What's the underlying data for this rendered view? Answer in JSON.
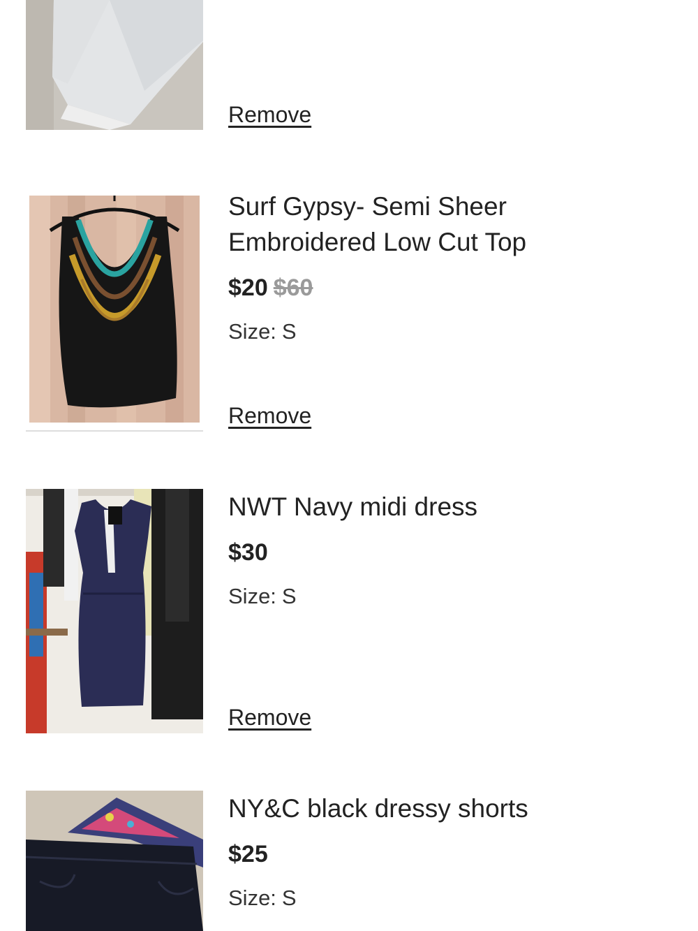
{
  "cart": {
    "items": [
      {
        "title": "",
        "price": "",
        "original_price": "",
        "size_label": "",
        "size": "",
        "remove_label": "Remove",
        "image": "grey-pants-photo"
      },
      {
        "title": "Surf Gypsy- Semi Sheer Embroidered Low Cut Top",
        "price": "$20",
        "original_price": "$60",
        "size_label": "Size:",
        "size": "S",
        "remove_label": "Remove",
        "image": "embroidered-top-photo"
      },
      {
        "title": "NWT Navy midi dress",
        "price": "$30",
        "original_price": "",
        "size_label": "Size:",
        "size": "S",
        "remove_label": "Remove",
        "image": "navy-dress-photo"
      },
      {
        "title": "NY&C black dressy shorts",
        "price": "$25",
        "original_price": "",
        "size_label": "Size:",
        "size": "S",
        "remove_label": "",
        "image": "black-shorts-photo"
      }
    ]
  }
}
